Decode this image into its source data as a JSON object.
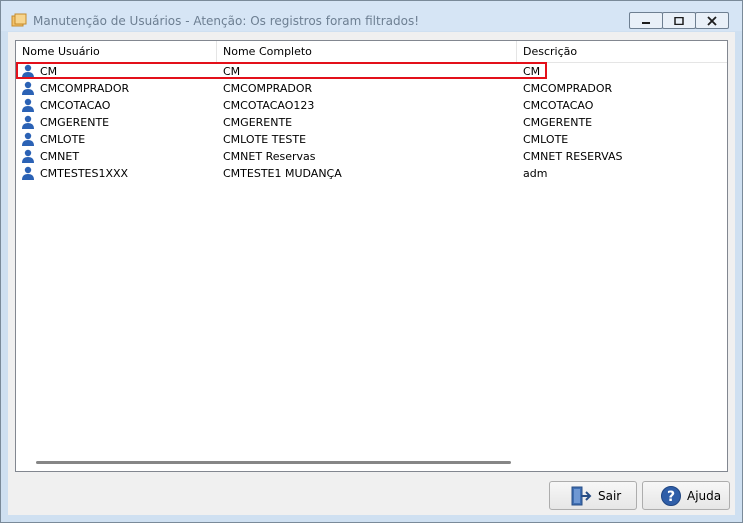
{
  "window": {
    "title": "Manutenção de Usuários - Atenção: Os registros foram filtrados!"
  },
  "columns": [
    "Nome Usuário",
    "Nome Completo",
    "Descrição"
  ],
  "rows": [
    {
      "user": "CM",
      "full": "CM",
      "desc": "CM"
    },
    {
      "user": "CMCOMPRADOR",
      "full": "CMCOMPRADOR",
      "desc": "CMCOMPRADOR"
    },
    {
      "user": "CMCOTACAO",
      "full": "CMCOTACAO123",
      "desc": "CMCOTACAO"
    },
    {
      "user": "CMGERENTE",
      "full": "CMGERENTE",
      "desc": "CMGERENTE"
    },
    {
      "user": "CMLOTE",
      "full": "CMLOTE TESTE",
      "desc": "CMLOTE"
    },
    {
      "user": "CMNET",
      "full": "CMNET Reservas",
      "desc": "CMNET RESERVAS"
    },
    {
      "user": "CMTESTES1XXX",
      "full": "CMTESTE1 MUDANÇA",
      "desc": "adm"
    }
  ],
  "buttons": {
    "exit_label": "Sair",
    "help_label": "Ajuda"
  },
  "colors": {
    "highlight": "#e3101a",
    "user_icon": "#2b62b5"
  },
  "icons": {
    "row": "user-icon",
    "exit": "exit-door-icon",
    "help": "help-icon"
  }
}
